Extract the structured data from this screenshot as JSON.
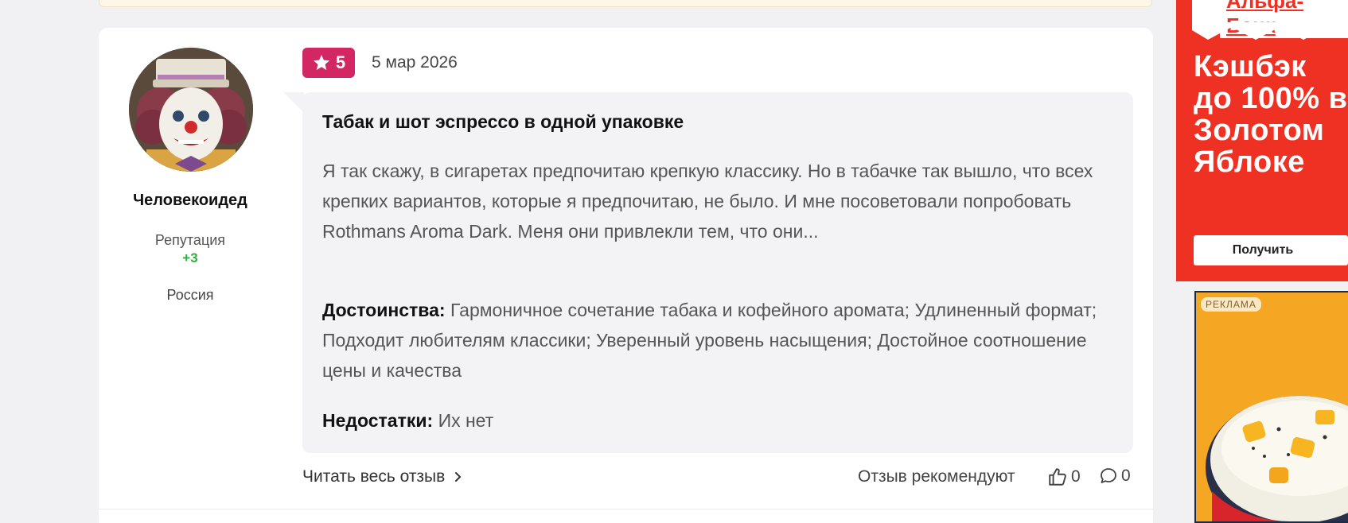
{
  "review": {
    "rating": "5",
    "date": "5 мар 2026",
    "title": "Табак и шот эспрессо в одной упаковке",
    "text": "Я так скажу, в сигаретах предпочитаю крепкую классику. Но в табачке так вышло, что всех крепких вариантов, которые я предпочитаю, не было. И мне посоветовали попробовать Rothmans Aroma Dark. Меня они привлекли тем, что они...",
    "pros_label": "Достоинства:",
    "pros": "Гармоничное сочетание табака и кофейного аромата; Удлиненный формат; Подходит любителям классики; Уверенный уровень насыщения; Достойное соотношение цены и качества",
    "cons_label": "Недостатки:",
    "cons": "Их нет",
    "read_more": "Читать весь отзыв",
    "recommend_label": "Отзыв рекомендуют",
    "likes": "0",
    "comments": "0"
  },
  "author": {
    "name": "Человекоидед",
    "reputation_label": "Репутация",
    "reputation_value": "+3",
    "country": "Россия"
  },
  "ads": {
    "ad1": {
      "brand": "Альфа-Банк",
      "headline": "Кэшбэк до 100% в Золотом Яблоке",
      "button": "Получить"
    },
    "ad2": {
      "tag": "РЕКЛАМА"
    }
  },
  "colors": {
    "rating_badge": "#d32763",
    "reputation": "#2bb13c",
    "ad1_bg": "#ef3124",
    "ad2_bg": "#f5a623"
  }
}
